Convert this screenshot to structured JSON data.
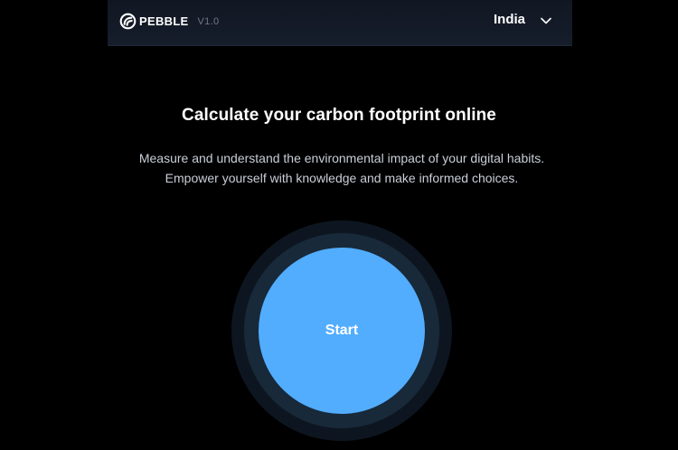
{
  "header": {
    "brand_name": "PEBBLE",
    "version": "V1.0",
    "logo_icon": "pebble-logo-icon",
    "country": "India",
    "country_chevron_icon": "chevron-down-icon"
  },
  "hero": {
    "title": "Calculate your carbon footprint online",
    "description": "Measure and understand the environmental impact of your digital habits. Empower yourself with knowledge and make informed choices."
  },
  "start_button": {
    "label": "Start"
  },
  "colors": {
    "background": "#000000",
    "header_bg": "#141b27",
    "accent": "#52adff",
    "ring_mid": "#18293a",
    "ring_outer": "#0d1620",
    "muted_text": "#6f7787"
  }
}
